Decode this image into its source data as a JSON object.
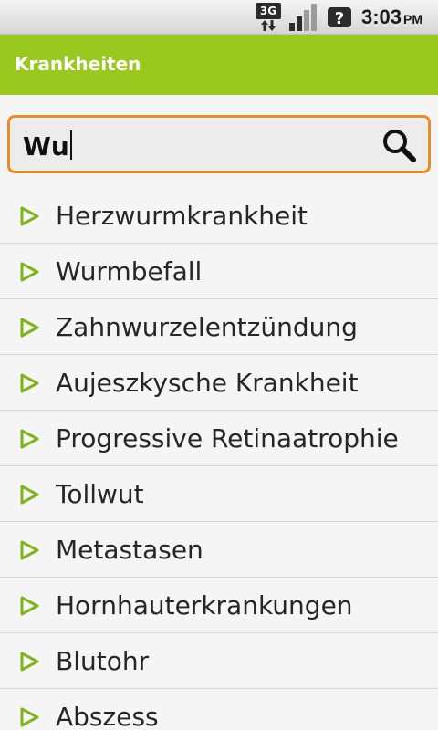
{
  "status_bar": {
    "network_type": "3G",
    "time": "3:03",
    "ampm": "PM"
  },
  "header": {
    "title": "Krankheiten"
  },
  "search": {
    "value": "Wu"
  },
  "results": [
    "Herzwurmkrankheit",
    "Wurmbefall",
    "Zahnwurzelentzündung",
    "Aujeszkysche Krankheit",
    "Progressive Retinaatrophie",
    "Tollwut",
    "Metastasen",
    "Hornhauterkrankungen",
    "Blutohr",
    "Abszess"
  ],
  "colors": {
    "accent": "#99c91e",
    "focus_border": "#f08a1c",
    "arrow": "#7fb31c"
  },
  "icons": {
    "network": "3g-data-icon",
    "signal": "signal-strength-icon",
    "sim": "no-sim-icon",
    "search": "search-icon",
    "list_bullet": "play-arrow-icon"
  }
}
